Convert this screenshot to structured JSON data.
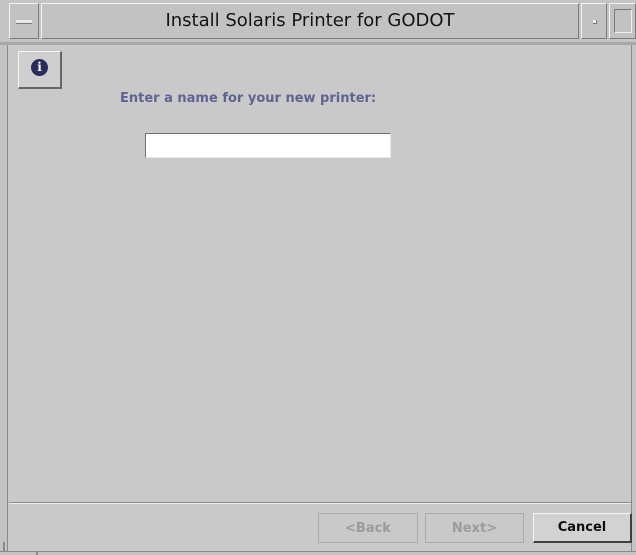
{
  "window": {
    "title": "Install Solaris Printer for GODOT"
  },
  "toolbar": {
    "info_icon": "info-icon",
    "info_glyph": "i"
  },
  "form": {
    "prompt": "Enter a name for your new printer:",
    "printer_name_value": "",
    "printer_name_placeholder": ""
  },
  "footer": {
    "back_label": "<Back",
    "next_label": "Next>",
    "cancel_label": "Cancel",
    "back_enabled": false,
    "next_enabled": false
  },
  "colors": {
    "background": "#c9c9c9",
    "prompt_text": "#5f6394",
    "disabled_text": "#9b9b9b",
    "info_icon_fill": "#2c2c5c"
  }
}
